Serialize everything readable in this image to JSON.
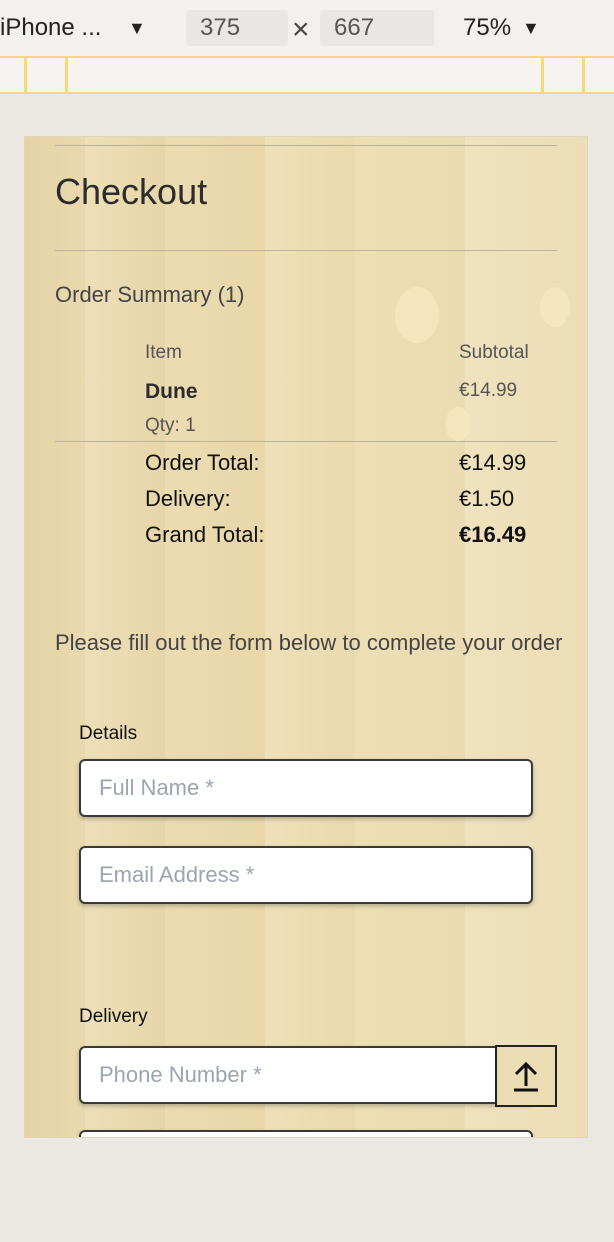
{
  "devtools": {
    "device": "iPhone ...",
    "width": "375",
    "times": "×",
    "height": "667",
    "zoom": "75%"
  },
  "page": {
    "title": "Checkout",
    "summary_heading": "Order Summary (1)",
    "table": {
      "col_item": "Item",
      "col_subtotal": "Subtotal",
      "items": [
        {
          "name": "Dune",
          "qty": "Qty: 1",
          "price": "€14.99"
        }
      ]
    },
    "totals": [
      {
        "label": "Order Total:",
        "value": "€14.99"
      },
      {
        "label": "Delivery:",
        "value": "€1.50"
      },
      {
        "label": "Grand Total:",
        "value": "€16.49"
      }
    ],
    "form_intro": "Please fill out the form below to complete your order",
    "details_label": "Details",
    "full_name_placeholder": "Full Name *",
    "email_placeholder": "Email Address *",
    "delivery_label": "Delivery",
    "phone_placeholder": "Phone Number *"
  },
  "colors": {
    "accent": "#f5d97a",
    "page_bg": "#ecdcb3"
  },
  "icons": {
    "device_dropdown": "triangle-down-icon",
    "zoom_dropdown": "triangle-down-icon",
    "scroll_top": "arrow-up-icon"
  }
}
